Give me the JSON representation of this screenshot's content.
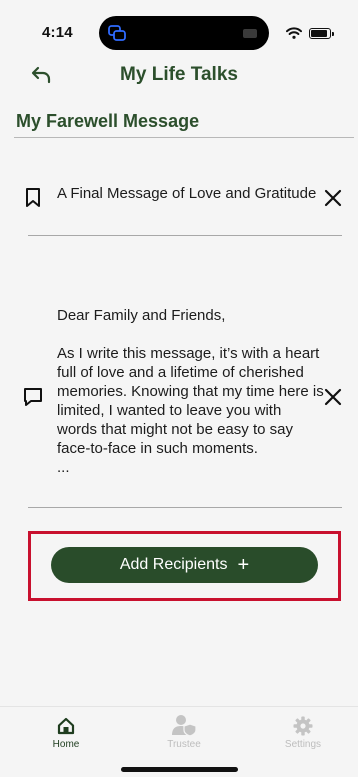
{
  "status": {
    "time": "4:14"
  },
  "header": {
    "title": "My Life Talks"
  },
  "section": {
    "title": "My Farewell Message"
  },
  "message": {
    "subject": "A Final Message of Love and Gratitude",
    "body_greeting": "Dear Family and Friends,",
    "body_text": "As I write this message, it’s with a heart full of love and a lifetime of cherished memories. Knowing that my time here is limited, I wanted to leave you with words that might not be easy to say face-to-face in such moments.",
    "body_ellipsis": "..."
  },
  "actions": {
    "add_recipients_label": "Add Recipients",
    "add_icon": "+"
  },
  "tabs": [
    {
      "label": "Home",
      "icon": "home-icon",
      "active": true
    },
    {
      "label": "Trustee",
      "icon": "trustee-icon",
      "active": false
    },
    {
      "label": "Settings",
      "icon": "gear-icon",
      "active": false
    }
  ],
  "colors": {
    "brand_green": "#294c2a",
    "title_green": "#2c4f2c",
    "highlight_red": "#c8102e",
    "inactive_gray": "#bdbdbd"
  }
}
